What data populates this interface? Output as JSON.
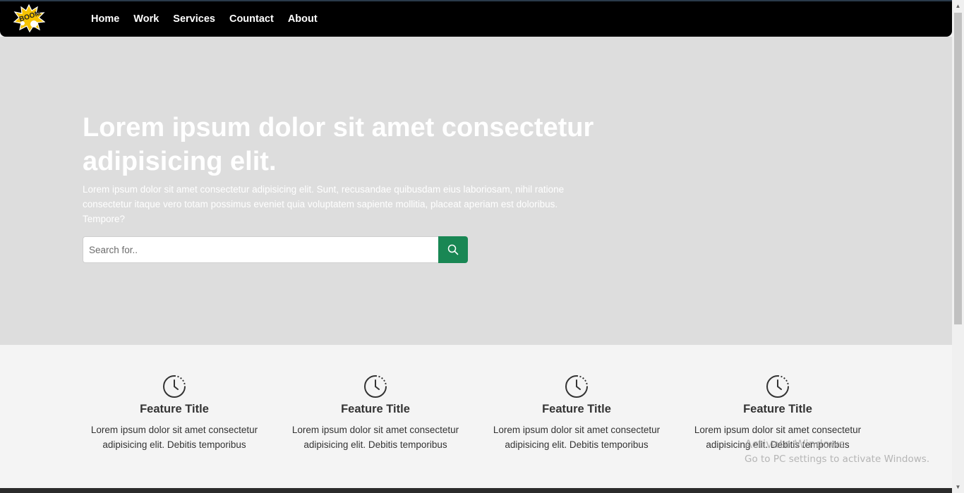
{
  "nav": {
    "logo_text": "BOOM",
    "links": [
      "Home",
      "Work",
      "Services",
      "Countact",
      "About"
    ]
  },
  "hero": {
    "title": "Lorem ipsum dolor sit amet consectetur adipisicing elit.",
    "text": "Lorem ipsum dolor sit amet consectetur adipisicing elit. Sunt, recusandae quibusdam eius laboriosam, nihil ratione consectetur itaque vero totam possimus eveniet quia voluptatem sapiente mollitia, placeat aperiam est doloribus. Tempore?",
    "search_placeholder": "Search for.."
  },
  "features": [
    {
      "icon": "clock-icon",
      "title": "Feature Title",
      "text": "Lorem ipsum dolor sit amet consectetur adipisicing elit. Debitis temporibus"
    },
    {
      "icon": "clock-icon",
      "title": "Feature Title",
      "text": "Lorem ipsum dolor sit amet consectetur adipisicing elit. Debitis temporibus"
    },
    {
      "icon": "clock-icon",
      "title": "Feature Title",
      "text": "Lorem ipsum dolor sit amet consectetur adipisicing elit. Debitis temporibus"
    },
    {
      "icon": "clock-icon",
      "title": "Feature Title",
      "text": "Lorem ipsum dolor sit amet consectetur adipisicing elit. Debitis temporibus"
    }
  ],
  "watermark": {
    "title": "Activate Windows",
    "subtitle": "Go to PC settings to activate Windows."
  },
  "colors": {
    "navbar": "#000000",
    "hero_bg": "#dddddd",
    "search_button": "#198754",
    "features_bg": "#f4f4f4"
  }
}
